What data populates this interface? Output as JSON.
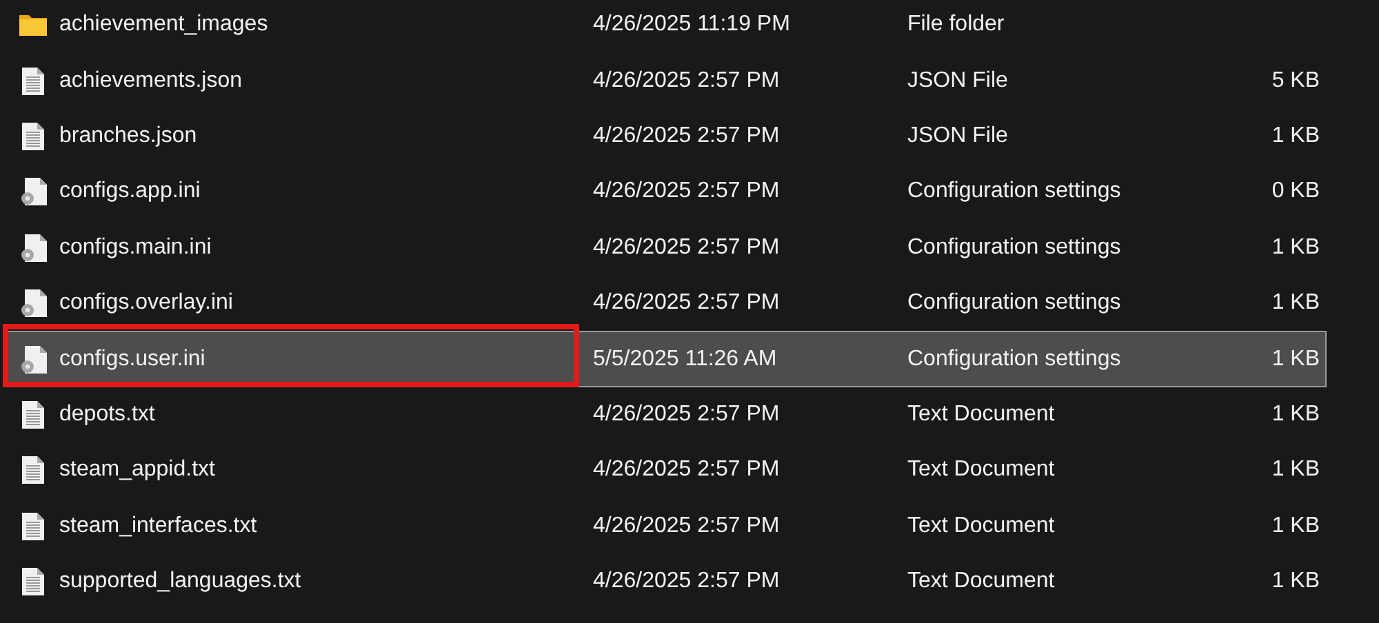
{
  "files": [
    {
      "kind": "folder",
      "name": "achievement_images",
      "modified": "4/26/2025 11:19 PM",
      "type": "File folder",
      "selected": false,
      "annotated": false
    },
    {
      "kind": "document",
      "name": "achievements.json",
      "modified": "4/26/2025 2:57 PM",
      "type": "JSON File",
      "size": "5 KB",
      "selected": false,
      "annotated": false
    },
    {
      "kind": "document",
      "name": "branches.json",
      "modified": "4/26/2025 2:57 PM",
      "type": "JSON File",
      "size": "1 KB",
      "selected": false,
      "annotated": false
    },
    {
      "kind": "settings",
      "name": "configs.app.ini",
      "modified": "4/26/2025 2:57 PM",
      "type": "Configuration settings",
      "size": "0 KB",
      "selected": false,
      "annotated": false
    },
    {
      "kind": "settings",
      "name": "configs.main.ini",
      "modified": "4/26/2025 2:57 PM",
      "type": "Configuration settings",
      "size": "1 KB",
      "selected": false,
      "annotated": false
    },
    {
      "kind": "settings",
      "name": "configs.overlay.ini",
      "modified": "4/26/2025 2:57 PM",
      "type": "Configuration settings",
      "size": "1 KB",
      "selected": false,
      "annotated": false
    },
    {
      "kind": "settings",
      "name": "configs.user.ini",
      "modified": "5/5/2025 11:26 AM",
      "type": "Configuration settings",
      "size": "1 KB",
      "selected": true,
      "annotated": true
    },
    {
      "kind": "document",
      "name": "depots.txt",
      "modified": "4/26/2025 2:57 PM",
      "type": "Text Document",
      "size": "1 KB",
      "selected": false,
      "annotated": false
    },
    {
      "kind": "document",
      "name": "steam_appid.txt",
      "modified": "4/26/2025 2:57 PM",
      "type": "Text Document",
      "size": "1 KB",
      "selected": false,
      "annotated": false
    },
    {
      "kind": "document",
      "name": "steam_interfaces.txt",
      "modified": "4/26/2025 2:57 PM",
      "type": "Text Document",
      "size": "1 KB",
      "selected": false,
      "annotated": false
    },
    {
      "kind": "document",
      "name": "supported_languages.txt",
      "modified": "4/26/2025 2:57 PM",
      "type": "Text Document",
      "size": "1 KB",
      "selected": false,
      "annotated": false
    }
  ]
}
